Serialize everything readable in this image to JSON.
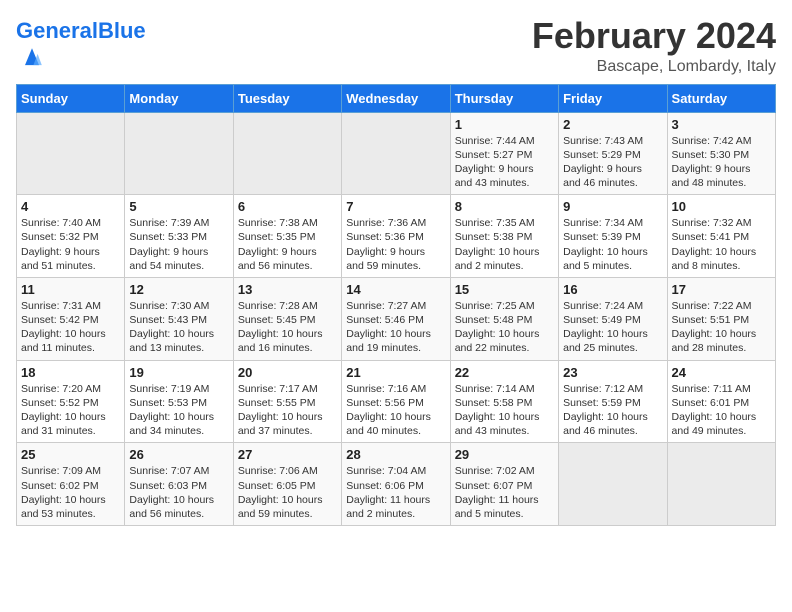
{
  "header": {
    "logo_general": "General",
    "logo_blue": "Blue",
    "title": "February 2024",
    "subtitle": "Bascape, Lombardy, Italy"
  },
  "weekdays": [
    "Sunday",
    "Monday",
    "Tuesday",
    "Wednesday",
    "Thursday",
    "Friday",
    "Saturday"
  ],
  "weeks": [
    [
      {
        "day": "",
        "info": ""
      },
      {
        "day": "",
        "info": ""
      },
      {
        "day": "",
        "info": ""
      },
      {
        "day": "",
        "info": ""
      },
      {
        "day": "1",
        "info": "Sunrise: 7:44 AM\nSunset: 5:27 PM\nDaylight: 9 hours\nand 43 minutes."
      },
      {
        "day": "2",
        "info": "Sunrise: 7:43 AM\nSunset: 5:29 PM\nDaylight: 9 hours\nand 46 minutes."
      },
      {
        "day": "3",
        "info": "Sunrise: 7:42 AM\nSunset: 5:30 PM\nDaylight: 9 hours\nand 48 minutes."
      }
    ],
    [
      {
        "day": "4",
        "info": "Sunrise: 7:40 AM\nSunset: 5:32 PM\nDaylight: 9 hours\nand 51 minutes."
      },
      {
        "day": "5",
        "info": "Sunrise: 7:39 AM\nSunset: 5:33 PM\nDaylight: 9 hours\nand 54 minutes."
      },
      {
        "day": "6",
        "info": "Sunrise: 7:38 AM\nSunset: 5:35 PM\nDaylight: 9 hours\nand 56 minutes."
      },
      {
        "day": "7",
        "info": "Sunrise: 7:36 AM\nSunset: 5:36 PM\nDaylight: 9 hours\nand 59 minutes."
      },
      {
        "day": "8",
        "info": "Sunrise: 7:35 AM\nSunset: 5:38 PM\nDaylight: 10 hours\nand 2 minutes."
      },
      {
        "day": "9",
        "info": "Sunrise: 7:34 AM\nSunset: 5:39 PM\nDaylight: 10 hours\nand 5 minutes."
      },
      {
        "day": "10",
        "info": "Sunrise: 7:32 AM\nSunset: 5:41 PM\nDaylight: 10 hours\nand 8 minutes."
      }
    ],
    [
      {
        "day": "11",
        "info": "Sunrise: 7:31 AM\nSunset: 5:42 PM\nDaylight: 10 hours\nand 11 minutes."
      },
      {
        "day": "12",
        "info": "Sunrise: 7:30 AM\nSunset: 5:43 PM\nDaylight: 10 hours\nand 13 minutes."
      },
      {
        "day": "13",
        "info": "Sunrise: 7:28 AM\nSunset: 5:45 PM\nDaylight: 10 hours\nand 16 minutes."
      },
      {
        "day": "14",
        "info": "Sunrise: 7:27 AM\nSunset: 5:46 PM\nDaylight: 10 hours\nand 19 minutes."
      },
      {
        "day": "15",
        "info": "Sunrise: 7:25 AM\nSunset: 5:48 PM\nDaylight: 10 hours\nand 22 minutes."
      },
      {
        "day": "16",
        "info": "Sunrise: 7:24 AM\nSunset: 5:49 PM\nDaylight: 10 hours\nand 25 minutes."
      },
      {
        "day": "17",
        "info": "Sunrise: 7:22 AM\nSunset: 5:51 PM\nDaylight: 10 hours\nand 28 minutes."
      }
    ],
    [
      {
        "day": "18",
        "info": "Sunrise: 7:20 AM\nSunset: 5:52 PM\nDaylight: 10 hours\nand 31 minutes."
      },
      {
        "day": "19",
        "info": "Sunrise: 7:19 AM\nSunset: 5:53 PM\nDaylight: 10 hours\nand 34 minutes."
      },
      {
        "day": "20",
        "info": "Sunrise: 7:17 AM\nSunset: 5:55 PM\nDaylight: 10 hours\nand 37 minutes."
      },
      {
        "day": "21",
        "info": "Sunrise: 7:16 AM\nSunset: 5:56 PM\nDaylight: 10 hours\nand 40 minutes."
      },
      {
        "day": "22",
        "info": "Sunrise: 7:14 AM\nSunset: 5:58 PM\nDaylight: 10 hours\nand 43 minutes."
      },
      {
        "day": "23",
        "info": "Sunrise: 7:12 AM\nSunset: 5:59 PM\nDaylight: 10 hours\nand 46 minutes."
      },
      {
        "day": "24",
        "info": "Sunrise: 7:11 AM\nSunset: 6:01 PM\nDaylight: 10 hours\nand 49 minutes."
      }
    ],
    [
      {
        "day": "25",
        "info": "Sunrise: 7:09 AM\nSunset: 6:02 PM\nDaylight: 10 hours\nand 53 minutes."
      },
      {
        "day": "26",
        "info": "Sunrise: 7:07 AM\nSunset: 6:03 PM\nDaylight: 10 hours\nand 56 minutes."
      },
      {
        "day": "27",
        "info": "Sunrise: 7:06 AM\nSunset: 6:05 PM\nDaylight: 10 hours\nand 59 minutes."
      },
      {
        "day": "28",
        "info": "Sunrise: 7:04 AM\nSunset: 6:06 PM\nDaylight: 11 hours\nand 2 minutes."
      },
      {
        "day": "29",
        "info": "Sunrise: 7:02 AM\nSunset: 6:07 PM\nDaylight: 11 hours\nand 5 minutes."
      },
      {
        "day": "",
        "info": ""
      },
      {
        "day": "",
        "info": ""
      }
    ]
  ]
}
